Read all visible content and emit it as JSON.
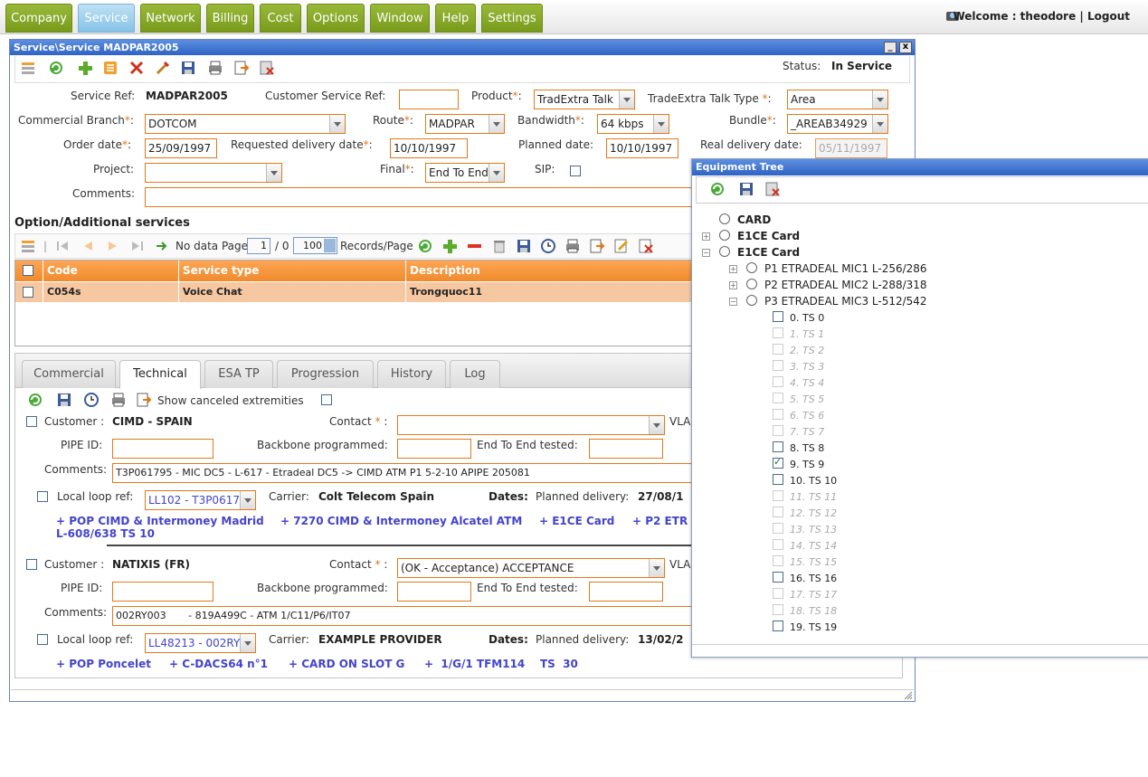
{
  "menu": {
    "tabs": [
      "Company",
      "Service",
      "Network",
      "Billing",
      "Cost",
      "Options",
      "Window",
      "Help",
      "Settings"
    ],
    "active": "Service",
    "welcome_prefix": "Welcome : ",
    "user": "theodore",
    "separator": " | ",
    "logout": "Logout"
  },
  "window": {
    "title": "Service\\Service MADPAR2005",
    "minimize": "_",
    "close": "x",
    "status_label": "Status:",
    "status_value": "In Service"
  },
  "form": {
    "service_ref_label": "Service Ref:",
    "service_ref_value": "MADPAR2005",
    "customer_service_ref_label": "Customer Service Ref:",
    "customer_service_ref_value": "",
    "product_label": "Product",
    "product_value": "TradExtra Talk",
    "tradextra_type_label": "TradeExtra Talk Type",
    "tradextra_type_value": "Area",
    "commercial_branch_label": "Commercial Branch",
    "commercial_branch_value": "DOTCOM",
    "route_label": "Route",
    "route_value": "MADPAR",
    "bandwidth_label": "Bandwidth",
    "bandwidth_value": "64 kbps",
    "bundle_label": "Bundle",
    "bundle_value": "_AREAB34929",
    "order_date_label": "Order date",
    "order_date_value": "25/09/1997",
    "requested_delivery_label": "Requested delivery date",
    "requested_delivery_value": "10/10/1997",
    "planned_date_label": "Planned date:",
    "planned_date_value": "10/10/1997",
    "real_delivery_label": "Real delivery date:",
    "real_delivery_value": "05/11/1997",
    "project_label": "Project:",
    "project_value": "",
    "final_label": "Final",
    "final_value": "End To End",
    "sip_label": "SIP:",
    "comments_label": "Comments:",
    "comments_value": "",
    "required_mark": "*",
    "colon": ":"
  },
  "options": {
    "title": "Option/Additional services",
    "pager_text": "No data Page",
    "page_value": "1",
    "page_total": "/ 0",
    "records_value": "100",
    "records_label": "Records/Page",
    "columns": [
      "Code",
      "Service type",
      "Description"
    ],
    "rows": [
      {
        "code": "C054s",
        "service_type": "Voice Chat",
        "description": "Trongquoc11"
      }
    ]
  },
  "tabs": {
    "items": [
      "Commercial",
      "Technical",
      "ESA TP",
      "Progression",
      "History",
      "Log"
    ],
    "active": "Technical",
    "show_canceled_label": "Show canceled extremities"
  },
  "extremities": [
    {
      "customer_label": "Customer :",
      "customer_value": "CIMD - SPAIN",
      "contact_label": "Contact",
      "contact_value": "",
      "vlan_label": "VLA",
      "pipe_label": "PIPE ID:",
      "backbone_label": "Backbone programmed:",
      "e2e_label": "End To End tested:",
      "comments_label": "Comments:",
      "comments_value": "T3P061795 - MIC DC5 - L-617 - Etradeal DC5 -> CIMD ATM P1 5-2-10           APIPE 205081",
      "local_loop_label": "Local loop ref:",
      "local_loop_value": "LL102 - T3P0617",
      "carrier_label": "Carrier:",
      "carrier_value": "Colt Telecom Spain",
      "dates_label": "Dates:",
      "planned_delivery_label": "Planned delivery:",
      "planned_delivery_value": "27/08/1",
      "links": [
        "+  POP CIMD & Intermoney Madrid",
        "+  7270 CIMD & Intermoney Alcatel ATM",
        "+  E1CE Card",
        "+  P2 ETR"
      ],
      "links_line2": "L-608/638    TS  10"
    },
    {
      "customer_label": "Customer :",
      "customer_value": "NATIXIS (FR)",
      "contact_label": "Contact",
      "contact_value": "(OK - Acceptance) ACCEPTANCE",
      "vlan_label": "VLA",
      "pipe_label": "PIPE ID:",
      "backbone_label": "Backbone programmed:",
      "e2e_label": "End To End tested:",
      "comments_label": "Comments:",
      "comments_value": "002RY003       - 819A499C - ATM 1/C11/P6/IT07",
      "local_loop_label": "Local loop ref:",
      "local_loop_value": "LL48213 - 002RY",
      "carrier_label": "Carrier:",
      "carrier_value": "EXAMPLE PROVIDER",
      "dates_label": "Dates:",
      "planned_delivery_label": "Planned delivery:",
      "planned_delivery_value": "13/02/2",
      "links": [
        "+  POP Poncelet",
        "+  C-DACS64 n°1",
        "+  CARD ON SLOT G",
        "+  1/G/1 TFM114    TS  30"
      ]
    }
  ],
  "equipment_tree": {
    "title": "Equipment Tree",
    "nodes": [
      {
        "label": "CARD"
      },
      {
        "label": "E1CE Card",
        "expander": "+"
      },
      {
        "label": "E1CE Card",
        "expander": "−"
      },
      {
        "label": "P1 ETRADEAL MIC1 L-256/286",
        "expander": "+"
      },
      {
        "label": "P2 ETRADEAL MIC2 L-288/318",
        "expander": "+"
      },
      {
        "label": "P3 ETRADEAL MIC3 L-512/542",
        "expander": "−"
      }
    ],
    "timeslots": [
      {
        "label": "0. TS 0",
        "state": "free"
      },
      {
        "label": "1. TS 1",
        "state": "used"
      },
      {
        "label": "2. TS 2",
        "state": "used"
      },
      {
        "label": "3. TS 3",
        "state": "used"
      },
      {
        "label": "4. TS 4",
        "state": "used"
      },
      {
        "label": "5. TS 5",
        "state": "used"
      },
      {
        "label": "6. TS 6",
        "state": "used"
      },
      {
        "label": "7. TS 7",
        "state": "used"
      },
      {
        "label": "8. TS 8",
        "state": "free"
      },
      {
        "label": "9. TS 9",
        "state": "checked"
      },
      {
        "label": "10. TS 10",
        "state": "free"
      },
      {
        "label": "11. TS 11",
        "state": "used"
      },
      {
        "label": "12. TS 12",
        "state": "used"
      },
      {
        "label": "13. TS 13",
        "state": "used"
      },
      {
        "label": "14. TS 14",
        "state": "used"
      },
      {
        "label": "15. TS 15",
        "state": "used"
      },
      {
        "label": "16. TS 16",
        "state": "free"
      },
      {
        "label": "17. TS 17",
        "state": "used"
      },
      {
        "label": "18. TS 18",
        "state": "used"
      },
      {
        "label": "19. TS 19",
        "state": "free"
      }
    ]
  }
}
